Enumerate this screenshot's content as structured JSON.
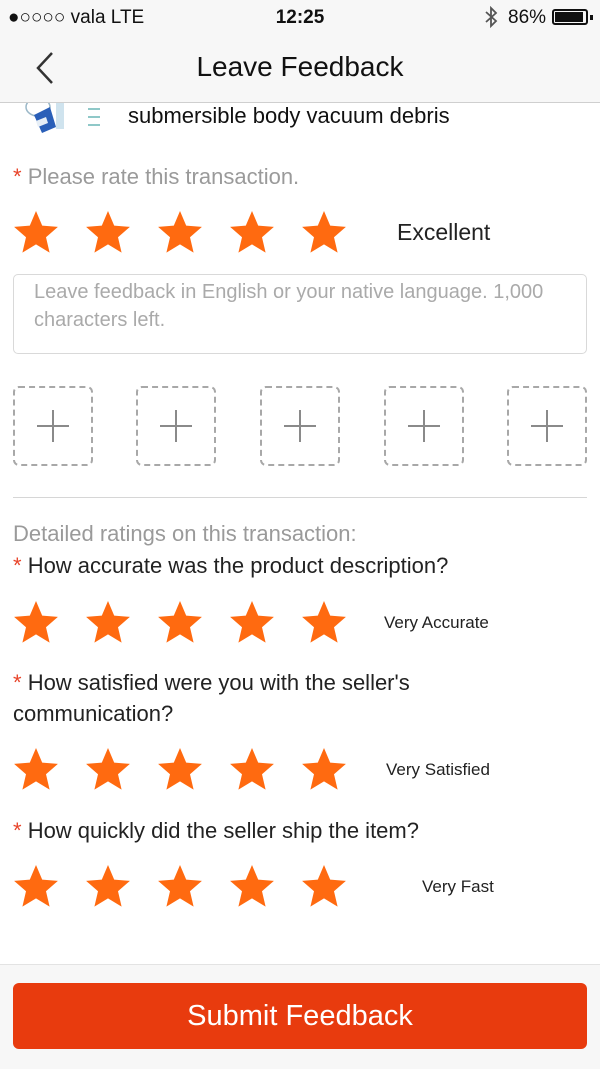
{
  "status_bar": {
    "carrier": "●○○○○ vala   LTE",
    "time": "12:25",
    "battery_percent": "86%",
    "battery_level": 0.86
  },
  "header": {
    "title": "Leave Feedback"
  },
  "product": {
    "name": "submersible body vacuum debris"
  },
  "overall": {
    "required_mark": "*",
    "prompt": "Please rate this transaction.",
    "stars": 5,
    "rating_label": "Excellent"
  },
  "feedback": {
    "placeholder": "Leave feedback in English or your native language. 1,000 characters left."
  },
  "photo_uploads": {
    "count": 5
  },
  "detailed": {
    "heading": "Detailed ratings on this transaction:",
    "questions": [
      {
        "required_mark": "*",
        "prompt": "How accurate was the product description?",
        "stars": 5,
        "rating_label": "Very Accurate"
      },
      {
        "required_mark": "*",
        "prompt": "How satisfied were you with the seller's communication?",
        "stars": 5,
        "rating_label": "Very Satisfied"
      },
      {
        "required_mark": "*",
        "prompt": "How quickly did the seller ship the item?",
        "stars": 5,
        "rating_label": "Very Fast"
      }
    ]
  },
  "submit_label": "Submit Feedback",
  "colors": {
    "star": "#ff6a10",
    "submit": "#e83b0e",
    "required": "#e8442a"
  }
}
